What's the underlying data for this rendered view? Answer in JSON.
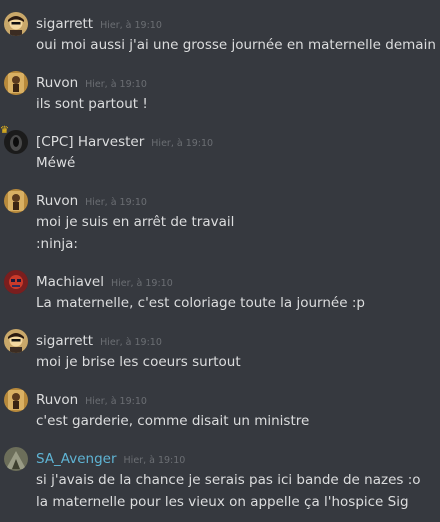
{
  "messages": [
    {
      "author": "sigarrett",
      "timestamp": "Hier, à 19:10",
      "avatar_icon": "avatar-sigarrett-icon",
      "lines": [
        "oui moi aussi j'ai une grosse journée en maternelle demain"
      ]
    },
    {
      "author": "Ruvon",
      "timestamp": "Hier, à 19:10",
      "avatar_icon": "avatar-ruvon-icon",
      "lines": [
        "ils sont partout !"
      ]
    },
    {
      "author": "[CPC] Harvester",
      "timestamp": "Hier, à 19:10",
      "avatar_icon": "avatar-harvester-icon",
      "lines": [
        "Méwé"
      ]
    },
    {
      "author": "Ruvon",
      "timestamp": "Hier, à 19:10",
      "avatar_icon": "avatar-ruvon-icon",
      "lines": [
        "moi je suis en arrêt de travail",
        ":ninja:"
      ]
    },
    {
      "author": "Machiavel",
      "timestamp": "Hier, à 19:10",
      "avatar_icon": "avatar-machiavel-icon",
      "lines": [
        "La maternelle, c'est coloriage toute la journée :p"
      ]
    },
    {
      "author": "sigarrett",
      "timestamp": "Hier, à 19:10",
      "avatar_icon": "avatar-sigarrett-icon",
      "lines": [
        "moi je brise les coeurs surtout"
      ]
    },
    {
      "author": "Ruvon",
      "timestamp": "Hier, à 19:10",
      "avatar_icon": "avatar-ruvon-icon",
      "lines": [
        "c'est garderie, comme disait un ministre"
      ]
    },
    {
      "author": "SA_Avenger",
      "timestamp": "Hier, à 19:10",
      "avatar_icon": "avatar-sa-avenger-icon",
      "author_color": "#5fb4d4",
      "lines": [
        "si j'avais de la chance je serais pas ici bande de nazes :o",
        "la maternelle pour les vieux on appelle ça l'hospice Sig"
      ]
    }
  ]
}
